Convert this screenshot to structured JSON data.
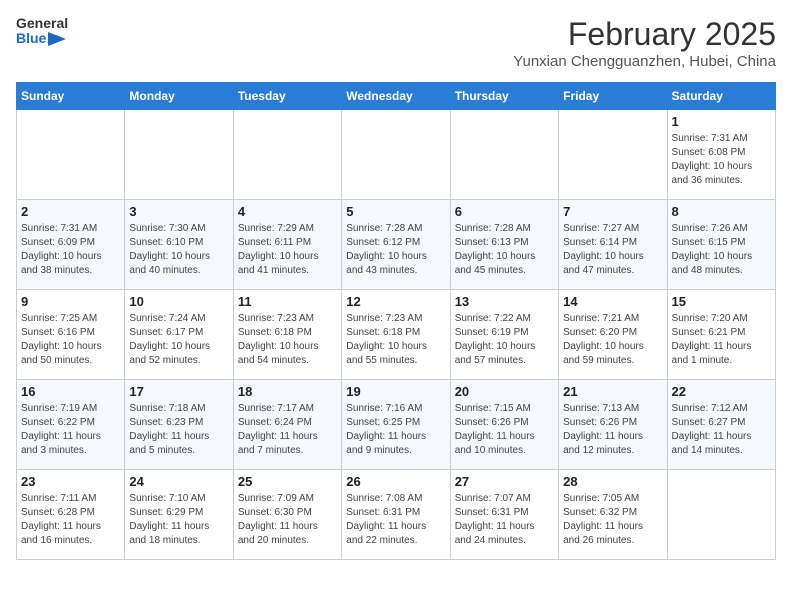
{
  "header": {
    "logo_line1": "General",
    "logo_line2": "Blue",
    "month": "February 2025",
    "location": "Yunxian Chengguanzhen, Hubei, China"
  },
  "days_of_week": [
    "Sunday",
    "Monday",
    "Tuesday",
    "Wednesday",
    "Thursday",
    "Friday",
    "Saturday"
  ],
  "weeks": [
    [
      {
        "day": "",
        "info": ""
      },
      {
        "day": "",
        "info": ""
      },
      {
        "day": "",
        "info": ""
      },
      {
        "day": "",
        "info": ""
      },
      {
        "day": "",
        "info": ""
      },
      {
        "day": "",
        "info": ""
      },
      {
        "day": "1",
        "info": "Sunrise: 7:31 AM\nSunset: 6:08 PM\nDaylight: 10 hours\nand 36 minutes."
      }
    ],
    [
      {
        "day": "2",
        "info": "Sunrise: 7:31 AM\nSunset: 6:09 PM\nDaylight: 10 hours\nand 38 minutes."
      },
      {
        "day": "3",
        "info": "Sunrise: 7:30 AM\nSunset: 6:10 PM\nDaylight: 10 hours\nand 40 minutes."
      },
      {
        "day": "4",
        "info": "Sunrise: 7:29 AM\nSunset: 6:11 PM\nDaylight: 10 hours\nand 41 minutes."
      },
      {
        "day": "5",
        "info": "Sunrise: 7:28 AM\nSunset: 6:12 PM\nDaylight: 10 hours\nand 43 minutes."
      },
      {
        "day": "6",
        "info": "Sunrise: 7:28 AM\nSunset: 6:13 PM\nDaylight: 10 hours\nand 45 minutes."
      },
      {
        "day": "7",
        "info": "Sunrise: 7:27 AM\nSunset: 6:14 PM\nDaylight: 10 hours\nand 47 minutes."
      },
      {
        "day": "8",
        "info": "Sunrise: 7:26 AM\nSunset: 6:15 PM\nDaylight: 10 hours\nand 48 minutes."
      }
    ],
    [
      {
        "day": "9",
        "info": "Sunrise: 7:25 AM\nSunset: 6:16 PM\nDaylight: 10 hours\nand 50 minutes."
      },
      {
        "day": "10",
        "info": "Sunrise: 7:24 AM\nSunset: 6:17 PM\nDaylight: 10 hours\nand 52 minutes."
      },
      {
        "day": "11",
        "info": "Sunrise: 7:23 AM\nSunset: 6:18 PM\nDaylight: 10 hours\nand 54 minutes."
      },
      {
        "day": "12",
        "info": "Sunrise: 7:23 AM\nSunset: 6:18 PM\nDaylight: 10 hours\nand 55 minutes."
      },
      {
        "day": "13",
        "info": "Sunrise: 7:22 AM\nSunset: 6:19 PM\nDaylight: 10 hours\nand 57 minutes."
      },
      {
        "day": "14",
        "info": "Sunrise: 7:21 AM\nSunset: 6:20 PM\nDaylight: 10 hours\nand 59 minutes."
      },
      {
        "day": "15",
        "info": "Sunrise: 7:20 AM\nSunset: 6:21 PM\nDaylight: 11 hours\nand 1 minute."
      }
    ],
    [
      {
        "day": "16",
        "info": "Sunrise: 7:19 AM\nSunset: 6:22 PM\nDaylight: 11 hours\nand 3 minutes."
      },
      {
        "day": "17",
        "info": "Sunrise: 7:18 AM\nSunset: 6:23 PM\nDaylight: 11 hours\nand 5 minutes."
      },
      {
        "day": "18",
        "info": "Sunrise: 7:17 AM\nSunset: 6:24 PM\nDaylight: 11 hours\nand 7 minutes."
      },
      {
        "day": "19",
        "info": "Sunrise: 7:16 AM\nSunset: 6:25 PM\nDaylight: 11 hours\nand 9 minutes."
      },
      {
        "day": "20",
        "info": "Sunrise: 7:15 AM\nSunset: 6:26 PM\nDaylight: 11 hours\nand 10 minutes."
      },
      {
        "day": "21",
        "info": "Sunrise: 7:13 AM\nSunset: 6:26 PM\nDaylight: 11 hours\nand 12 minutes."
      },
      {
        "day": "22",
        "info": "Sunrise: 7:12 AM\nSunset: 6:27 PM\nDaylight: 11 hours\nand 14 minutes."
      }
    ],
    [
      {
        "day": "23",
        "info": "Sunrise: 7:11 AM\nSunset: 6:28 PM\nDaylight: 11 hours\nand 16 minutes."
      },
      {
        "day": "24",
        "info": "Sunrise: 7:10 AM\nSunset: 6:29 PM\nDaylight: 11 hours\nand 18 minutes."
      },
      {
        "day": "25",
        "info": "Sunrise: 7:09 AM\nSunset: 6:30 PM\nDaylight: 11 hours\nand 20 minutes."
      },
      {
        "day": "26",
        "info": "Sunrise: 7:08 AM\nSunset: 6:31 PM\nDaylight: 11 hours\nand 22 minutes."
      },
      {
        "day": "27",
        "info": "Sunrise: 7:07 AM\nSunset: 6:31 PM\nDaylight: 11 hours\nand 24 minutes."
      },
      {
        "day": "28",
        "info": "Sunrise: 7:05 AM\nSunset: 6:32 PM\nDaylight: 11 hours\nand 26 minutes."
      },
      {
        "day": "",
        "info": ""
      }
    ]
  ]
}
